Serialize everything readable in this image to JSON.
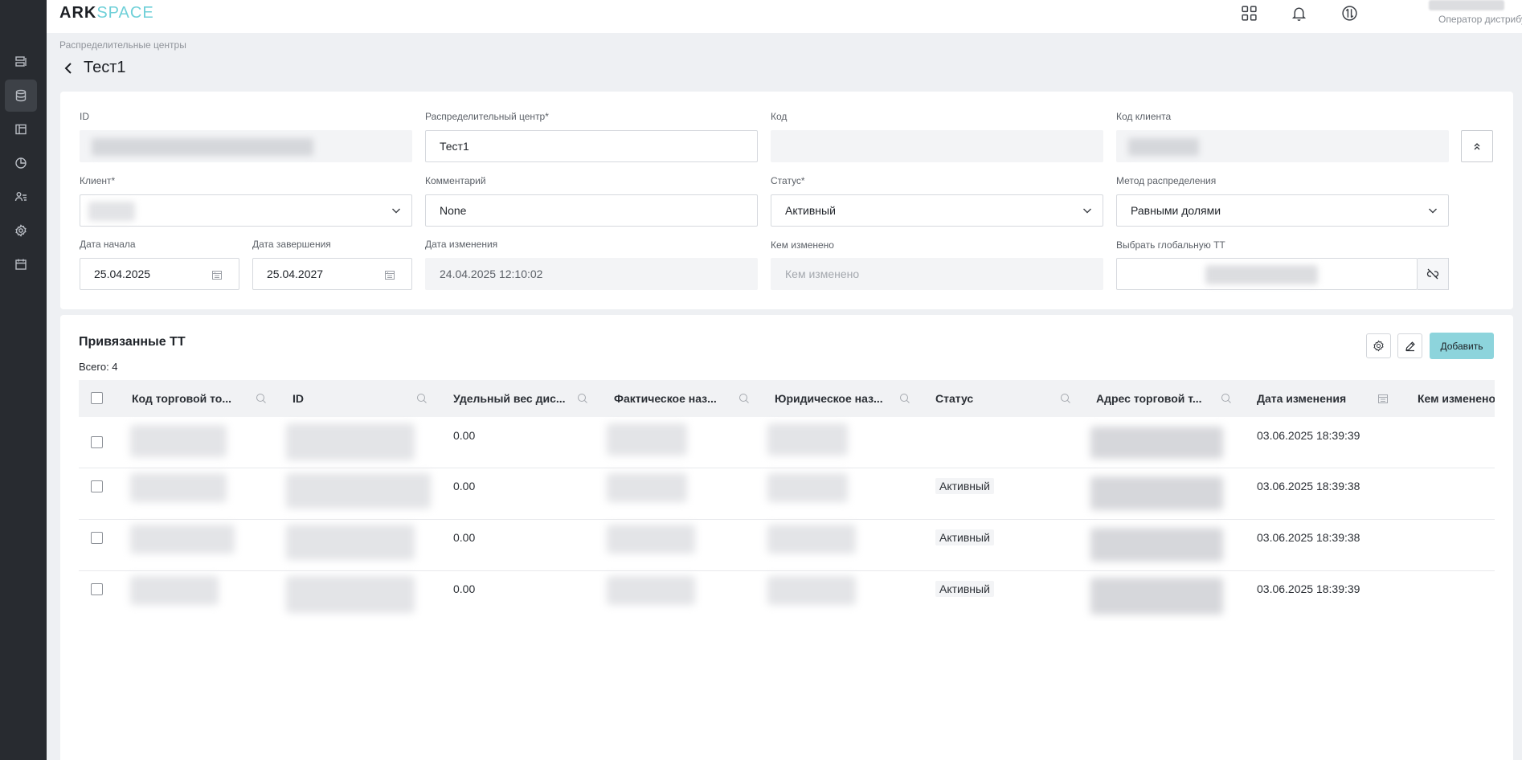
{
  "app": {
    "logo_ark": "ARK",
    "logo_space": "SPACE"
  },
  "user": {
    "role": "Оператор дистрибу..."
  },
  "breadcrumb": "Распределительные центры",
  "page_title": "Тест1",
  "form": {
    "id_label": "ID",
    "dc_label": "Распределительный центр*",
    "dc_value": "Тест1",
    "code_label": "Код",
    "client_code_label": "Код клиента",
    "client_label": "Клиент*",
    "comment_label": "Комментарий",
    "comment_value": "None",
    "status_label": "Статус*",
    "status_value": "Активный",
    "method_label": "Метод распределения",
    "method_value": "Равными долями",
    "start_label": "Дата начала",
    "start_value": "25.04.2025",
    "end_label": "Дата завершения",
    "end_value": "25.04.2027",
    "modified_label": "Дата изменения",
    "modified_value": "24.04.2025 12:10:02",
    "modified_by_label": "Кем изменено",
    "modified_by_placeholder": "Кем изменено",
    "global_tt_label": "Выбрать глобальную ТТ"
  },
  "table": {
    "title": "Привязанные ТТ",
    "total": "Всего: 4",
    "add_label": "Добавить",
    "columns": [
      "Код торговой то...",
      "ID",
      "Удельный вес дис...",
      "Фактическое наз...",
      "Юридическое наз...",
      "Статус",
      "Адрес торговой т...",
      "Дата изменения",
      "Кем изменено"
    ],
    "rows": [
      {
        "weight": "0.00",
        "status": "",
        "date": "03.06.2025 18:39:39"
      },
      {
        "weight": "0.00",
        "status": "Активный",
        "date": "03.06.2025 18:39:38"
      },
      {
        "weight": "0.00",
        "status": "Активный",
        "date": "03.06.2025 18:39:38"
      },
      {
        "weight": "0.00",
        "status": "Активный",
        "date": "03.06.2025 18:39:39"
      }
    ]
  },
  "icons": {
    "sidebar": [
      "list-icon",
      "database-icon",
      "layout-icon",
      "pie-chart-icon",
      "users-icon",
      "settings-icon",
      "calendar-icon"
    ],
    "topbar": [
      "apps-grid-icon",
      "bell-icon",
      "sync-icon",
      "chevron-down-icon"
    ]
  },
  "colors": {
    "accent": "#8dd4dc",
    "logo_space": "#6fd0d8",
    "sidebar": "#282b30"
  }
}
